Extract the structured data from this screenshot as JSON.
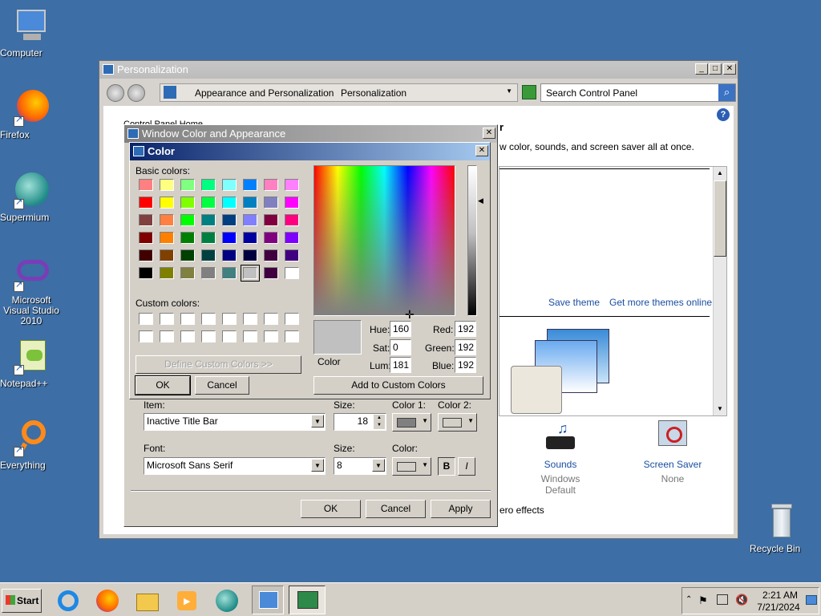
{
  "desktop": {
    "icons": [
      {
        "label": "Computer"
      },
      {
        "label": "Firefox"
      },
      {
        "label": "Supermium"
      },
      {
        "label": "Microsoft Visual Studio 2010"
      },
      {
        "label": "Notepad++"
      },
      {
        "label": "Everything"
      },
      {
        "label": "Recycle Bin"
      }
    ]
  },
  "personalization": {
    "title": "Personalization",
    "breadcrumb": [
      "Appearance and Personalization",
      "Personalization"
    ],
    "search_placeholder": "Search Control Panel",
    "cp_home": "Control Panel Home",
    "heading_tail": "r",
    "subtext": "w color, sounds, and screen saver all at once.",
    "save_theme": "Save theme",
    "more_themes": "Get more themes online",
    "sounds_label": "Sounds",
    "sounds_value": "Windows Default",
    "screensaver_label": "Screen Saver",
    "screensaver_value": "None",
    "aero_link": "ero effects"
  },
  "window_color": {
    "title": "Window Color and Appearance",
    "item_label": "Item:",
    "item_value": "Inactive Title Bar",
    "size_label": "Size:",
    "size_value": "18",
    "color1_label": "Color 1:",
    "color2_label": "Color 2:",
    "font_label": "Font:",
    "font_value": "Microsoft Sans Serif",
    "font_size_label": "Size:",
    "font_size_value": "8",
    "font_color_label": "Color:",
    "bold": "B",
    "italic": "I",
    "ok": "OK",
    "cancel": "Cancel",
    "apply": "Apply"
  },
  "color_dialog": {
    "title": "Color",
    "basic_colors_label": "Basic colors:",
    "custom_colors_label": "Custom colors:",
    "define_custom": "Define Custom Colors >>",
    "ok": "OK",
    "cancel": "Cancel",
    "add_custom": "Add to Custom Colors",
    "color_solid_label": "Color",
    "hue_label": "Hue:",
    "hue": "160",
    "sat_label": "Sat:",
    "sat": "0",
    "lum_label": "Lum:",
    "lum": "181",
    "red_label": "Red:",
    "red": "192",
    "green_label": "Green:",
    "green": "192",
    "blue_label": "Blue:",
    "blue": "192",
    "basic_colors": [
      "#ff8080",
      "#ffff80",
      "#80ff80",
      "#00ff80",
      "#80ffff",
      "#0080ff",
      "#ff80c0",
      "#ff80ff",
      "#ff0000",
      "#ffff00",
      "#80ff00",
      "#00ff40",
      "#00ffff",
      "#0080c0",
      "#8080c0",
      "#ff00ff",
      "#804040",
      "#ff8040",
      "#00ff00",
      "#008080",
      "#004080",
      "#8080ff",
      "#800040",
      "#ff0080",
      "#800000",
      "#ff8000",
      "#008000",
      "#008040",
      "#0000ff",
      "#0000a0",
      "#800080",
      "#8000ff",
      "#400000",
      "#804000",
      "#004000",
      "#004040",
      "#000080",
      "#000040",
      "#400040",
      "#400080",
      "#000000",
      "#808000",
      "#808040",
      "#808080",
      "#408080",
      "#c0c0c0",
      "#400040",
      "#ffffff"
    ],
    "selected_index": 45
  },
  "taskbar": {
    "start": "Start",
    "time": "2:21 AM",
    "date": "7/21/2024"
  }
}
